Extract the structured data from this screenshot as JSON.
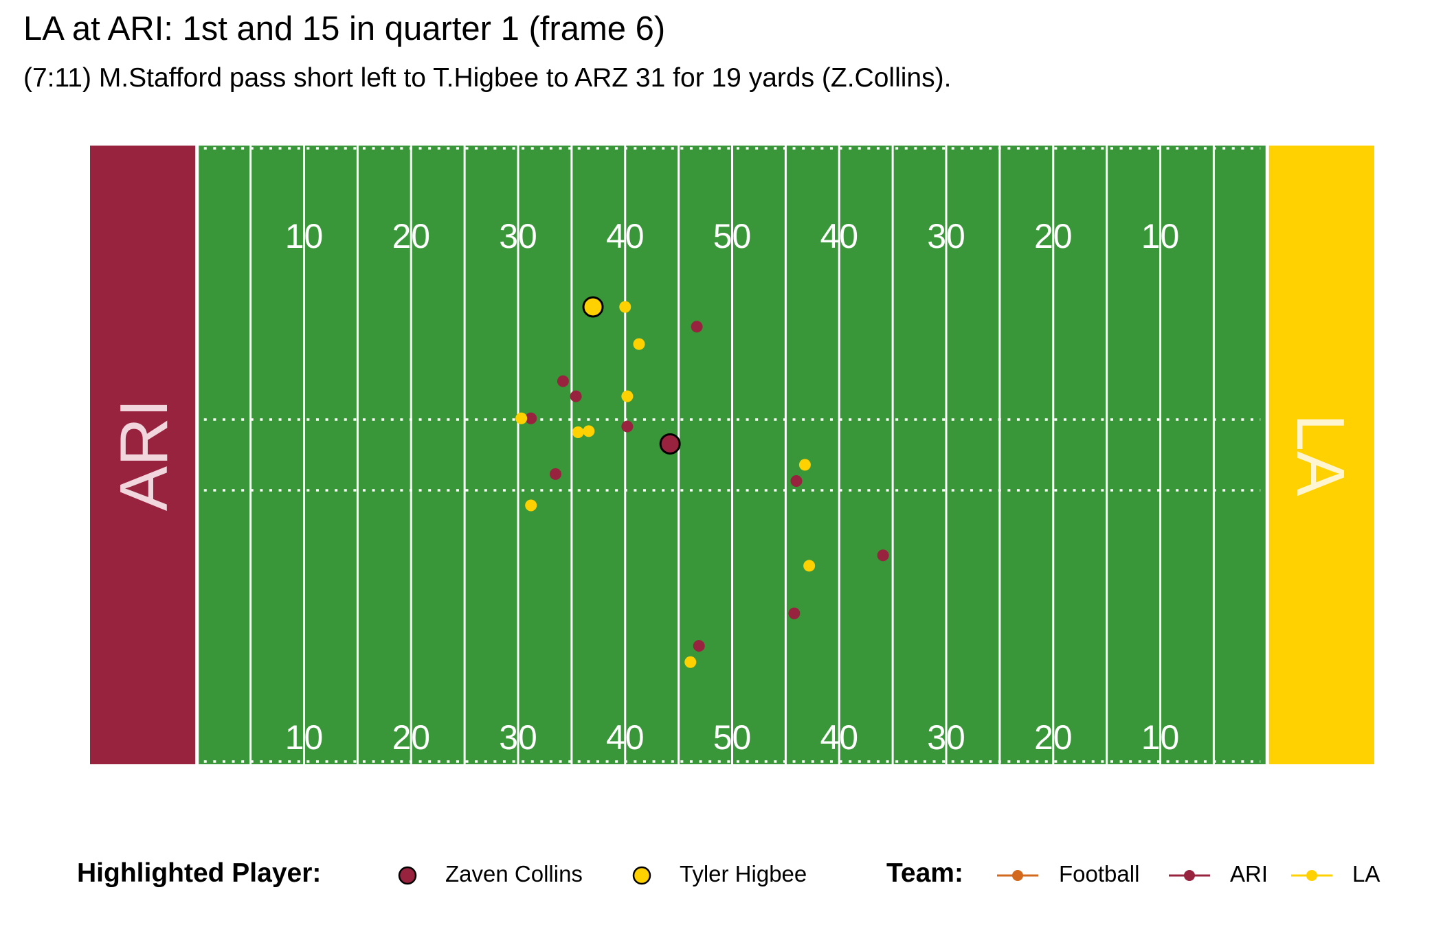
{
  "title": "LA at ARI: 1st and 15 in quarter 1 (frame 6)",
  "subtitle": "(7:11) M.Stafford pass short left to T.Higbee to ARZ 31 for 19 yards (Z.Collins).",
  "chart_data": {
    "type": "scatter",
    "x_range": [
      0,
      120
    ],
    "y_range": [
      0,
      53.3
    ],
    "yard_numbers": [
      "10",
      "20",
      "30",
      "40",
      "50",
      "40",
      "30",
      "20",
      "10"
    ],
    "endzones": {
      "left": {
        "label": "ARI",
        "color": "#97233F"
      },
      "right": {
        "label": "LA",
        "color": "#FFD100"
      }
    },
    "field_color": "#3A9739",
    "series": [
      {
        "name": "ARI",
        "color": "#97233F",
        "points": [
          [
            56.7,
            37.7
          ],
          [
            44.2,
            33.0
          ],
          [
            45.4,
            31.7
          ],
          [
            41.2,
            29.8
          ],
          [
            50.2,
            29.1
          ],
          [
            43.5,
            25.0
          ],
          [
            66.0,
            24.4
          ],
          [
            74.1,
            18.0
          ],
          [
            65.8,
            13.0
          ],
          [
            56.9,
            10.2
          ]
        ]
      },
      {
        "name": "LA",
        "color": "#FFD100",
        "points": [
          [
            50.0,
            39.4
          ],
          [
            51.3,
            36.2
          ],
          [
            50.2,
            31.7
          ],
          [
            40.3,
            29.8
          ],
          [
            45.6,
            28.6
          ],
          [
            46.6,
            28.7
          ],
          [
            66.8,
            25.8
          ],
          [
            41.2,
            22.3
          ],
          [
            67.2,
            17.1
          ],
          [
            56.1,
            8.8
          ]
        ]
      }
    ],
    "highlighted": [
      {
        "name": "Zaven Collins",
        "team": "ARI",
        "color": "#97233F",
        "x": 54.2,
        "y": 27.6
      },
      {
        "name": "Tyler Higbee",
        "team": "LA",
        "color": "#FFD100",
        "x": 47.0,
        "y": 39.4
      }
    ],
    "legend": {
      "highlighted_title": "Highlighted Player:",
      "highlighted_items": [
        {
          "label": "Zaven Collins",
          "color": "#97233F"
        },
        {
          "label": "Tyler Higbee",
          "color": "#FFD100"
        }
      ],
      "team_title": "Team:",
      "team_items": [
        {
          "label": "Football",
          "color": "#D2691E"
        },
        {
          "label": "ARI",
          "color": "#97233F"
        },
        {
          "label": "LA",
          "color": "#FFD100"
        }
      ]
    }
  }
}
